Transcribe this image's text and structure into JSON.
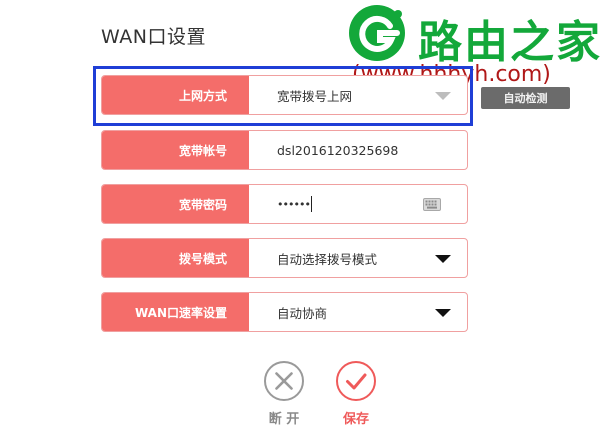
{
  "page_title": "WAN口设置",
  "watermark": {
    "site_name": "路由之家",
    "url": "(www.hhhyh.com)"
  },
  "form": {
    "fields": [
      {
        "label": "上网方式",
        "value": "宽带拨号上网",
        "control": "select",
        "disabled": true
      },
      {
        "label": "宽带帐号",
        "value": "dsl2016120325698",
        "control": "text"
      },
      {
        "label": "宽带密码",
        "value": "••••••",
        "control": "password"
      },
      {
        "label": "拨号模式",
        "value": "自动选择拨号模式",
        "control": "select"
      },
      {
        "label": "WAN口速率设置",
        "value": "自动协商",
        "control": "select"
      }
    ],
    "auto_detect_label": "自动检测"
  },
  "actions": {
    "disconnect_label": "断 开",
    "save_label": "保存"
  },
  "colors": {
    "label_bg": "#f46d6a",
    "accent": "#ef5a5a",
    "highlight": "#1f3ed6",
    "watermark_green": "#13a83a",
    "watermark_red": "#b01818"
  }
}
